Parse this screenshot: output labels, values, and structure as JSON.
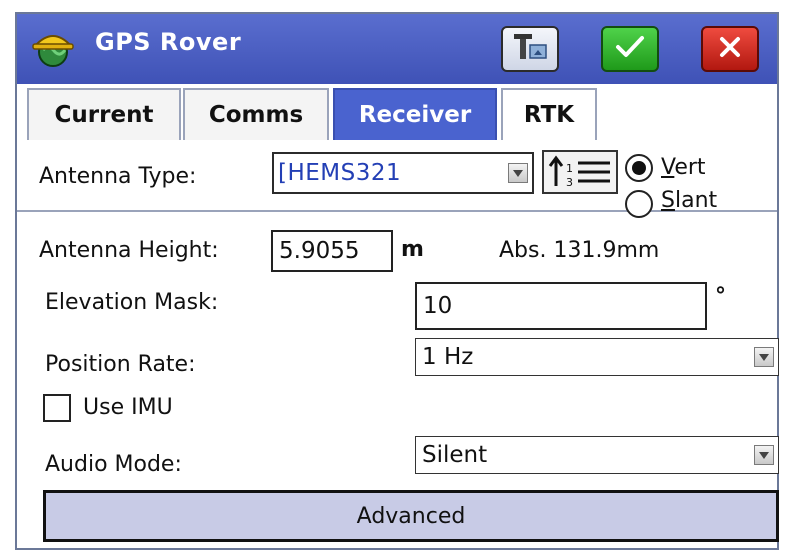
{
  "window": {
    "title": "GPS Rover",
    "icons": {
      "app": "hard-hat-globe-icon",
      "tools": "tools-icon",
      "ok": "checkmark-icon",
      "close": "close-icon"
    }
  },
  "tabs": [
    {
      "label": "Current",
      "active": false
    },
    {
      "label": "Comms",
      "active": false
    },
    {
      "label": "Receiver",
      "active": true
    },
    {
      "label": "RTK",
      "active": false
    }
  ],
  "form": {
    "antenna_type": {
      "label": "Antenna Type:",
      "value": "[HEMS321"
    },
    "measurement_mode": {
      "options": [
        {
          "accel": "V",
          "rest": "ert",
          "selected": true
        },
        {
          "accel": "S",
          "rest": "lant",
          "selected": false
        }
      ]
    },
    "antenna_height": {
      "label": "Antenna Height:",
      "value": "5.9055",
      "unit": "m",
      "abs": "Abs. 131.9mm"
    },
    "elevation_mask": {
      "label": "Elevation Mask:",
      "value": "10",
      "unit": "°"
    },
    "position_rate": {
      "label": "Position Rate:",
      "value": "1 Hz"
    },
    "use_imu": {
      "label": "Use IMU",
      "checked": false
    },
    "audio_mode": {
      "label": "Audio Mode:",
      "value": "Silent"
    },
    "advanced_label": "Advanced"
  },
  "colors": {
    "titlebar": "#4a5ec6",
    "active_tab": "#4a63cf",
    "ok": "#2fb52a",
    "close": "#d42a20",
    "antenna_text": "#233fb5",
    "advanced_bg": "#c8cbe6"
  }
}
